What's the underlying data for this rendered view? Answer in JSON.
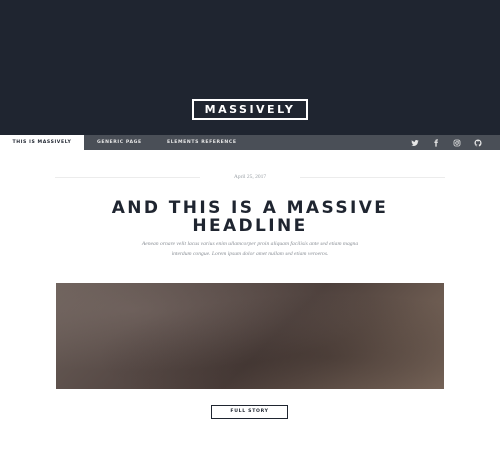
{
  "header": {
    "logo": "MASSIVELY"
  },
  "nav": {
    "tabs": [
      {
        "label": "THIS IS MASSIVELY",
        "active": true
      },
      {
        "label": "GENERIC PAGE",
        "active": false
      },
      {
        "label": "ELEMENTS REFERENCE",
        "active": false
      }
    ],
    "icons": [
      "twitter-icon",
      "facebook-icon",
      "instagram-icon",
      "github-icon"
    ]
  },
  "post": {
    "date": "April 25, 2017",
    "headline": "AND THIS IS A MASSIVE HEADLINE",
    "body": "Aenean ornare velit lacus varius enim ullamcorper proin aliquam facilisis ante sed etiam magna interdum congue. Lorem ipsum dolor amet nullam sed etiam veroeros.",
    "button_label": "FULL STORY"
  },
  "colors": {
    "dark": "#1f2530",
    "nav_bar": "#4a4f57",
    "white": "#ffffff"
  }
}
